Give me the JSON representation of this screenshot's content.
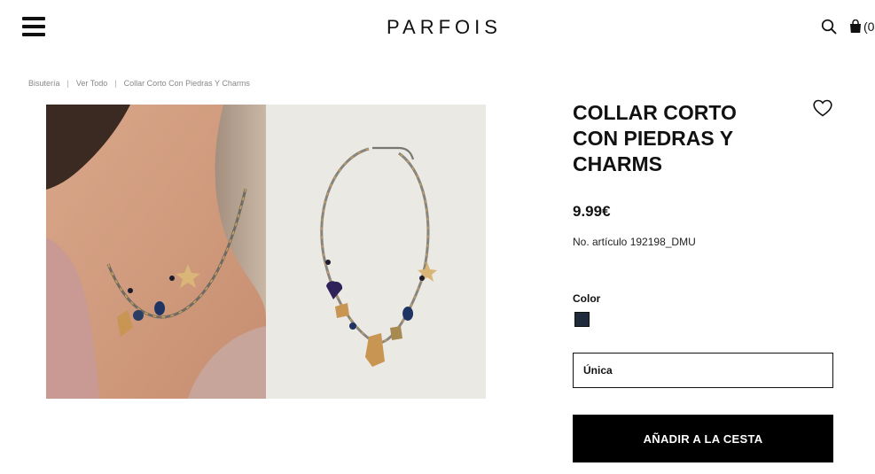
{
  "header": {
    "logo": "PARFOIS",
    "bag_count": "(0"
  },
  "breadcrumb": [
    "Bisutería",
    "Ver Todo",
    "Collar Corto Con Piedras Y Charms"
  ],
  "product": {
    "title": "COLLAR CORTO CON PIEDRAS Y CHARMS",
    "price": "9.99€",
    "sku": "No. artículo 192198_DMU",
    "color_label": "Color",
    "swatch_color": "#1f2a3a",
    "size_value": "Única",
    "add_to_cart_label": "AÑADIR A LA CESTA"
  },
  "icons": {
    "menu": "hamburger-menu-icon",
    "search": "search-icon",
    "bag": "shopping-bag-icon",
    "wishlist": "heart-icon"
  }
}
